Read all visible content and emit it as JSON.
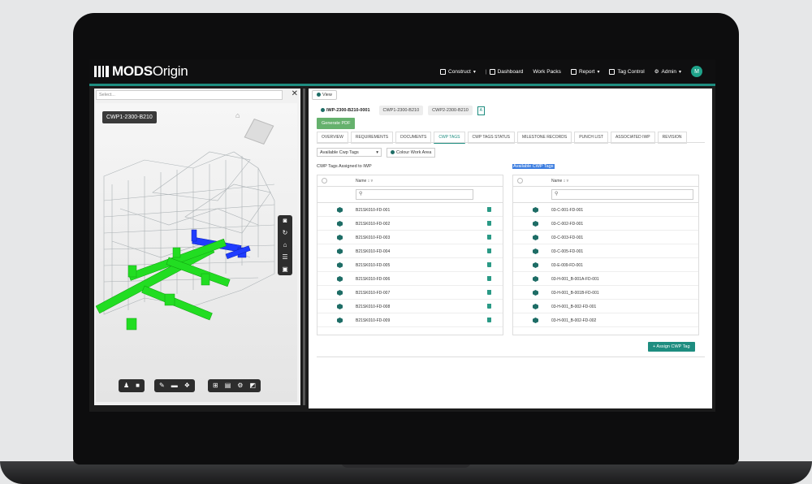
{
  "app": {
    "logo_mods": "MODS",
    "logo_origin": "Origin"
  },
  "nav": {
    "construct": "Construct",
    "dashboard": "Dashboard",
    "work_packs": "Work Packs",
    "report": "Report",
    "tag_control": "Tag Control",
    "admin": "Admin",
    "avatar_initial": "M"
  },
  "left": {
    "select_placeholder": "Select...",
    "close": "✕",
    "cwp_badge": "CWP1-2300-B210"
  },
  "right": {
    "view_label": "View",
    "breadcrumbs": [
      "IWP-2300-B210-0001",
      "CWP1-2300-B210",
      "CWP2-2300-B210"
    ],
    "generate_pdf": "Generate PDF",
    "tabs": [
      "OVERVIEW",
      "REQUIREMENTS",
      "DOCUMENTS",
      "CWP TAGS",
      "CWP TAGS STATUS",
      "MILESTONE RECORDS",
      "PUNCH LIST",
      "ASSOCIATED IWP",
      "REVISION"
    ],
    "active_tab": "CWP TAGS",
    "select_value": "Available Cwp Tags",
    "colour_work_area": "Colour Work Area",
    "assigned_title": "CWP Tags Assigned to IWP",
    "available_title": "Available CWP Tags",
    "name_col": "Name",
    "assigned_tags": [
      "B21SK010-FD-001",
      "B21SK010-FD-002",
      "B21SK010-FD-003",
      "B21SK010-FD-004",
      "B21SK010-FD-005",
      "B21SK010-FD-006",
      "B21SK010-FD-007",
      "B21SK010-FD-008",
      "B21SK010-FD-009"
    ],
    "available_tags": [
      "03-C-001-FD-001",
      "03-C-002-FD-001",
      "03-C-003-FD-001",
      "03-C-005-FD-001",
      "03-E-009-FD-001",
      "03-H-001_B-001A-FD-001",
      "03-H-001_B-001B-FD-001",
      "03-H-001_B-002-FD-001",
      "03-H-001_B-002-FD-002"
    ],
    "assign_button": "+ Assign CWP Tag"
  },
  "colors": {
    "accent": "#1e8d80",
    "pdf_green": "#65b16d",
    "highlight": "#3d7ee0"
  }
}
